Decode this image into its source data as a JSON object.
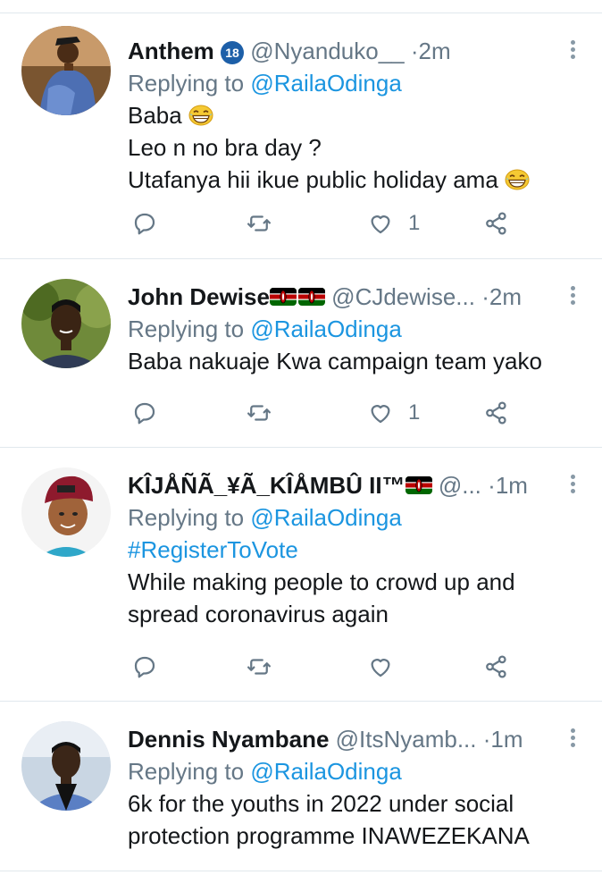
{
  "tweets": [
    {
      "name": "Anthem",
      "handle": "@Nyanduko__",
      "separator": "·",
      "time": "2m",
      "replying_prefix": "Replying to",
      "replying_to": "@RailaOdinga",
      "lines": [
        "Baba",
        "Leo n no bra day ?",
        "Utafanya hii ikue public holiday ama"
      ],
      "likes": "1",
      "badge": "18"
    },
    {
      "name": "John Dewise",
      "handle": "@CJdewise...",
      "separator": "·",
      "time": "2m",
      "replying_prefix": "Replying to",
      "replying_to": "@RailaOdinga",
      "lines": [
        "Baba nakuaje Kwa campaign team yako"
      ],
      "likes": "1"
    },
    {
      "name": "KÎJÅÑÃ_¥Ã_KÎÅMBÛ II™",
      "handle": "@...",
      "separator": "·",
      "time": "1m",
      "replying_prefix": "Replying to",
      "replying_to": "@RailaOdinga",
      "hashtag": "#RegisterToVote",
      "lines": [
        "While making people to crowd up and",
        "spread coronavirus again"
      ],
      "likes": ""
    },
    {
      "name": "Dennis Nyambane",
      "handle": "@ItsNyamb...",
      "separator": "·",
      "time": "1m",
      "replying_prefix": "Replying to",
      "replying_to": "@RailaOdinga",
      "lines": [
        "6k for the youths in 2022 under social",
        "protection programme INAWEZEKANA"
      ]
    }
  ],
  "colors": {
    "link": "#1b95e0",
    "muted": "#657786",
    "divider": "#e1e8ed"
  },
  "icons": [
    "reply-icon",
    "retweet-icon",
    "like-icon",
    "share-icon",
    "more-icon",
    "kenya-flag-icon",
    "grinning-emoji-icon"
  ]
}
